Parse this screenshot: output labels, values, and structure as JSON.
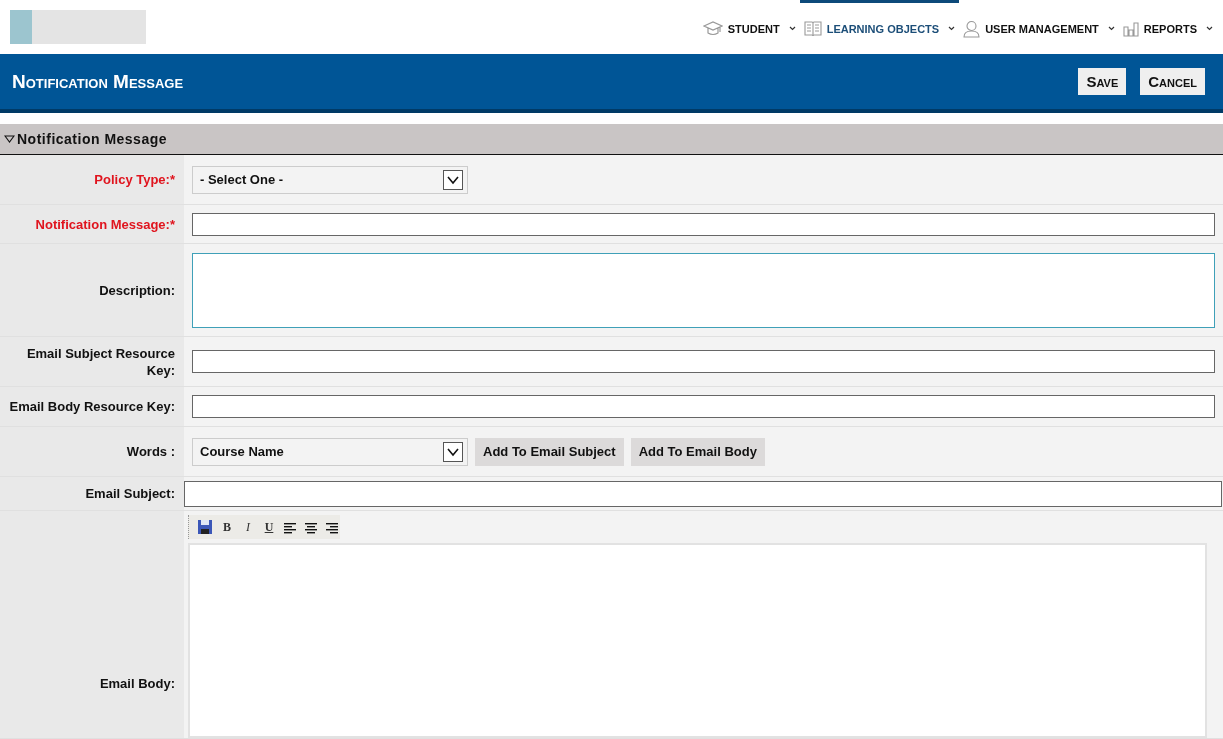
{
  "nav": [
    {
      "label": "STUDENT",
      "kind": "students",
      "selected": false
    },
    {
      "label": "LEARNING OBJECTS",
      "kind": "learning",
      "selected": true
    },
    {
      "label": "USER MANAGEMENT",
      "kind": "users",
      "selected": false
    },
    {
      "label": "REPORTS",
      "kind": "reports",
      "selected": false
    }
  ],
  "page_title": "Notification Message",
  "actions": [
    "Save",
    "Cancel"
  ],
  "section": {
    "title": "Notification Message",
    "expanded": true
  },
  "fields": [
    {
      "kind": "select",
      "label": "Policy Type:*",
      "required": true,
      "value": "- Select One -"
    },
    {
      "kind": "input",
      "label": "Notification Message:*",
      "required": true
    },
    {
      "kind": "textarea",
      "label": "Description:",
      "required": false
    },
    {
      "kind": "input",
      "label": "Email Subject Resource Key:",
      "required": false
    },
    {
      "kind": "input",
      "label": "Email Body Resource Key:",
      "required": false
    },
    {
      "kind": "words",
      "label": "Words :",
      "required": false,
      "value": "Course Name",
      "buttons": [
        "Add To Email Subject",
        "Add To Email Body"
      ]
    },
    {
      "kind": "wide-input",
      "label": "Email Subject:",
      "required": false
    },
    {
      "kind": "editor",
      "label": "Email Body:",
      "required": false,
      "toolbar": [
        {
          "kind": "save"
        },
        {
          "kind": "bold",
          "label": "B"
        },
        {
          "kind": "italic",
          "label": "I"
        },
        {
          "kind": "underline",
          "label": "U"
        },
        {
          "kind": "align-left"
        },
        {
          "kind": "align-center"
        },
        {
          "kind": "align-right"
        }
      ]
    }
  ]
}
